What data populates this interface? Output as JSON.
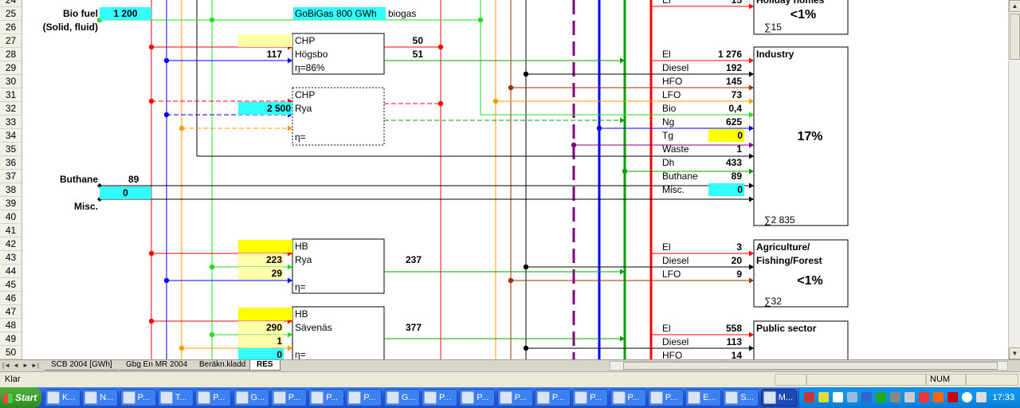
{
  "rows": [
    "24",
    "25",
    "26",
    "27",
    "28",
    "29",
    "30",
    "31",
    "32",
    "33",
    "34",
    "35",
    "36",
    "37",
    "38",
    "39",
    "40",
    "41",
    "42",
    "43",
    "44",
    "45",
    "46",
    "47",
    "48",
    "49",
    "50"
  ],
  "cells": {
    "bio_fuel": "Bio fuel",
    "bio_fuel_sub": "(Solid, fluid)",
    "bio_fuel_val": "1 200",
    "gobigas": "GoBiGas 800 GWh",
    "biogas": "biogas",
    "chp1_title": "CHP",
    "chp1_name": "Högsbo",
    "chp1_eta": "η=86%",
    "chp1_in": "117",
    "chp1_out1": "50",
    "chp1_out2": "51",
    "chp2_title": "CHP",
    "chp2_name": "Rya",
    "chp2_eta": "η=",
    "chp2_in": "2 500",
    "buthane": "Buthane",
    "buthane_val": "89",
    "buthane_zero": "0",
    "misc": "Misc.",
    "hb1_title": "HB",
    "hb1_name": "Rya",
    "hb1_in1": "223",
    "hb1_in2": "29",
    "hb1_eta": "η=",
    "hb1_out": "237",
    "hb2_title": "HB",
    "hb2_name": "Sävenäs",
    "hb2_in1": "290",
    "hb2_in2": "1",
    "hb2_in3": "0",
    "hb2_eta": "η=",
    "hb2_out": "377"
  },
  "sectors": {
    "holiday": {
      "title": "Holiday homes",
      "pct": "<1%",
      "sum": "∑15",
      "items": [
        {
          "label": "El",
          "val": "15"
        }
      ]
    },
    "industry": {
      "title": "Industry",
      "pct": "17%",
      "sum": "∑2 835",
      "items": [
        {
          "label": "El",
          "val": "1 276"
        },
        {
          "label": "Diesel",
          "val": "192"
        },
        {
          "label": "HFO",
          "val": "145"
        },
        {
          "label": "LFO",
          "val": "73"
        },
        {
          "label": "Bio",
          "val": "0,4"
        },
        {
          "label": "Ng",
          "val": "625"
        },
        {
          "label": "Tg",
          "val": "0"
        },
        {
          "label": "Waste",
          "val": "1"
        },
        {
          "label": "Dh",
          "val": "433"
        },
        {
          "label": "Buthane",
          "val": "89"
        },
        {
          "label": "Misc.",
          "val": "0"
        }
      ]
    },
    "agri": {
      "title1": "Agriculture/",
      "title2": "Fishing/Forest",
      "pct": "<1%",
      "sum": "∑32",
      "items": [
        {
          "label": "El",
          "val": "3"
        },
        {
          "label": "Diesel",
          "val": "20"
        },
        {
          "label": "LFO",
          "val": "9"
        }
      ]
    },
    "public": {
      "title": "Public sector",
      "items": [
        {
          "label": "El",
          "val": "558"
        },
        {
          "label": "Diesel",
          "val": "113"
        },
        {
          "label": "HFO",
          "val": "14"
        }
      ]
    }
  },
  "sheet_tabs": [
    "SCB 2004 [GWh]",
    "Gbg En MR 2004",
    "Beräkn.kladd",
    "RES"
  ],
  "status": {
    "left": "Klar",
    "num": "NUM"
  },
  "taskbar": {
    "start": "Start",
    "items": [
      "K...",
      "N...",
      "P...",
      "T...",
      "P...",
      "G...",
      "P...",
      "P...",
      "P...",
      "G...",
      "P...",
      "P...",
      "P...",
      "P...",
      "P...",
      "P...",
      "P...",
      "E...",
      "S...",
      "M..."
    ],
    "clock": "17:33"
  },
  "colors": {
    "red": "#ff0000",
    "green": "#00a000",
    "lime": "#22dd22",
    "blue": "#0000ff",
    "orange": "#ff9900",
    "brown": "#993300",
    "purple": "#800080",
    "black": "#000000",
    "cyan": "#33ffff",
    "yellow": "#ffff00"
  }
}
